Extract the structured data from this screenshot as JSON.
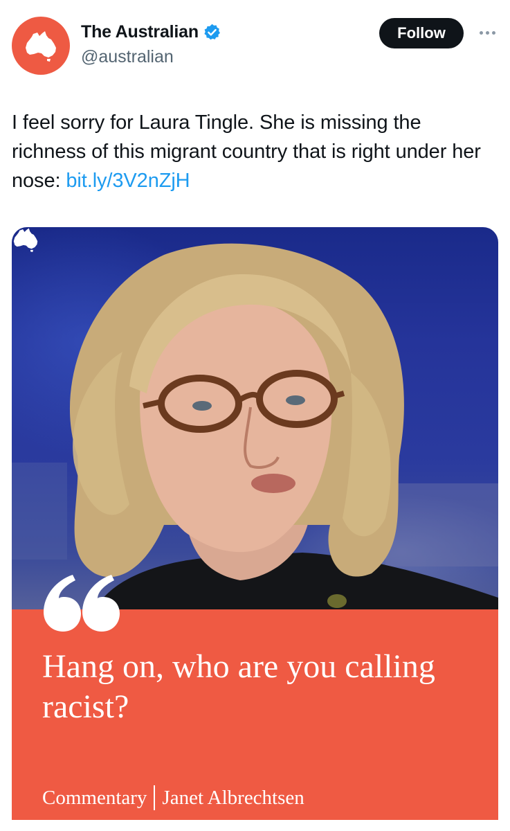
{
  "account": {
    "display_name": "The Australian",
    "handle": "@australian",
    "verified_icon": "verified-badge-icon",
    "avatar_icon": "australia-map-icon",
    "brand_color": "#ee5a43",
    "verified_color": "#1d9bf0"
  },
  "actions": {
    "follow_label": "Follow",
    "more_icon": "more-options-icon"
  },
  "tweet": {
    "text": "I feel sorry for Laura Tingle. She is missing the richness of this migrant country that is right under her nose: ",
    "link": "bit.ly/3V2nZjH"
  },
  "media": {
    "card_logo_icon": "australia-map-icon",
    "quote_icon": "quote-marks-icon",
    "headline": "Hang on, who are you calling racist?",
    "section": "Commentary",
    "author": "Janet Albrechtsen",
    "panel_color": "#ef5a43"
  }
}
